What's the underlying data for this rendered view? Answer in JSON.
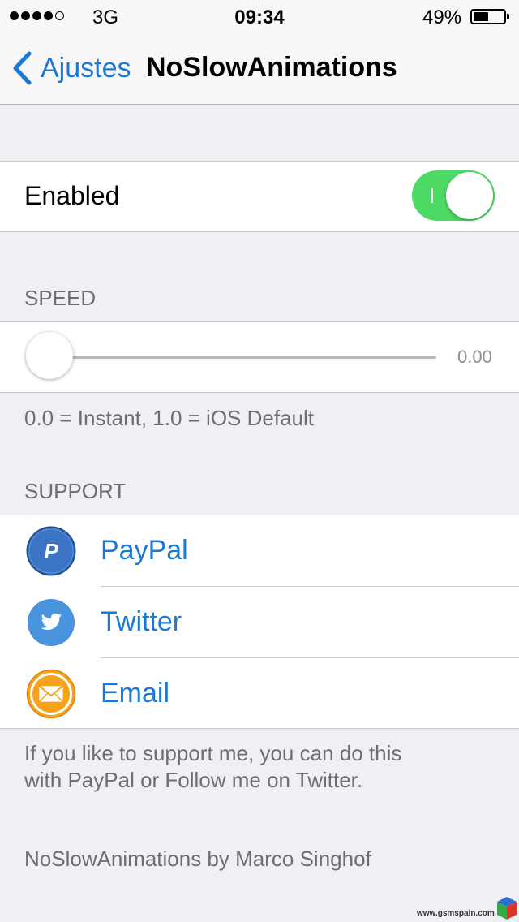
{
  "status_bar": {
    "carrier": "3G",
    "time": "09:34",
    "battery_percent_label": "49%",
    "battery_level": 0.49,
    "signal_bars_filled": 4,
    "signal_bars_total": 5
  },
  "nav": {
    "back_label": "Ajustes",
    "title": "NoSlowAnimations"
  },
  "enabled": {
    "label": "Enabled",
    "value": true,
    "toggle_on_color": "#4cd964"
  },
  "speed": {
    "header": "SPEED",
    "value": 0.0,
    "value_label": "0.00",
    "min": 0.0,
    "max": 1.0,
    "footer": "0.0 = Instant, 1.0 = iOS Default"
  },
  "support": {
    "header": "SUPPORT",
    "items": [
      {
        "label": "PayPal",
        "icon": "paypal-icon"
      },
      {
        "label": "Twitter",
        "icon": "twitter-icon"
      },
      {
        "label": "Email",
        "icon": "email-icon"
      }
    ],
    "footer_line1": "If you like to support me, you can do this",
    "footer_line2": "with PayPal or Follow me on Twitter."
  },
  "credit": "NoSlowAnimations by Marco Singhof",
  "watermark": "www.gsmspain.com",
  "colors": {
    "accent": "#1a78d7",
    "background": "#efeff4",
    "paypal": "#3b74c4",
    "twitter": "#3b8ee0",
    "email": "#f6a21a"
  }
}
